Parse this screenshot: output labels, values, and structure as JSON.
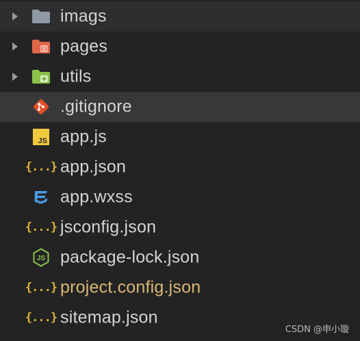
{
  "explorer": {
    "items": [
      {
        "label": "imags",
        "kind": "folder",
        "icon": "folder-icon"
      },
      {
        "label": "pages",
        "kind": "folder",
        "icon": "pages-folder-icon"
      },
      {
        "label": "utils",
        "kind": "folder",
        "icon": "utils-folder-icon"
      },
      {
        "label": ".gitignore",
        "kind": "file",
        "icon": "git-icon"
      },
      {
        "label": "app.js",
        "kind": "file",
        "icon": "js-file-icon"
      },
      {
        "label": "app.json",
        "kind": "file",
        "icon": "json-file-icon"
      },
      {
        "label": "app.wxss",
        "kind": "file",
        "icon": "css-file-icon"
      },
      {
        "label": "jsconfig.json",
        "kind": "file",
        "icon": "json-file-icon"
      },
      {
        "label": "package-lock.json",
        "kind": "file",
        "icon": "nodejs-file-icon"
      },
      {
        "label": "project.config.json",
        "kind": "file",
        "icon": "json-file-icon",
        "modified": true
      },
      {
        "label": "sitemap.json",
        "kind": "file",
        "icon": "json-file-icon"
      }
    ]
  },
  "icons": {
    "js_badge": "JS",
    "json_glyph": "{...}"
  },
  "colors": {
    "background": "#232324",
    "selected_row": "#38383a",
    "hover_row": "#2e2e30",
    "text": "#d4d4d4",
    "modified_text": "#d8b872",
    "folder_gray": "#8f9aa6",
    "folder_pages": "#e0664a",
    "folder_utils": "#8bc34a",
    "git": "#e34f26",
    "js": "#f0c93c",
    "json": "#e0b43a",
    "css": "#4a9ce8",
    "node": "#8bc34a"
  },
  "watermark": "CSDN @申小璇"
}
